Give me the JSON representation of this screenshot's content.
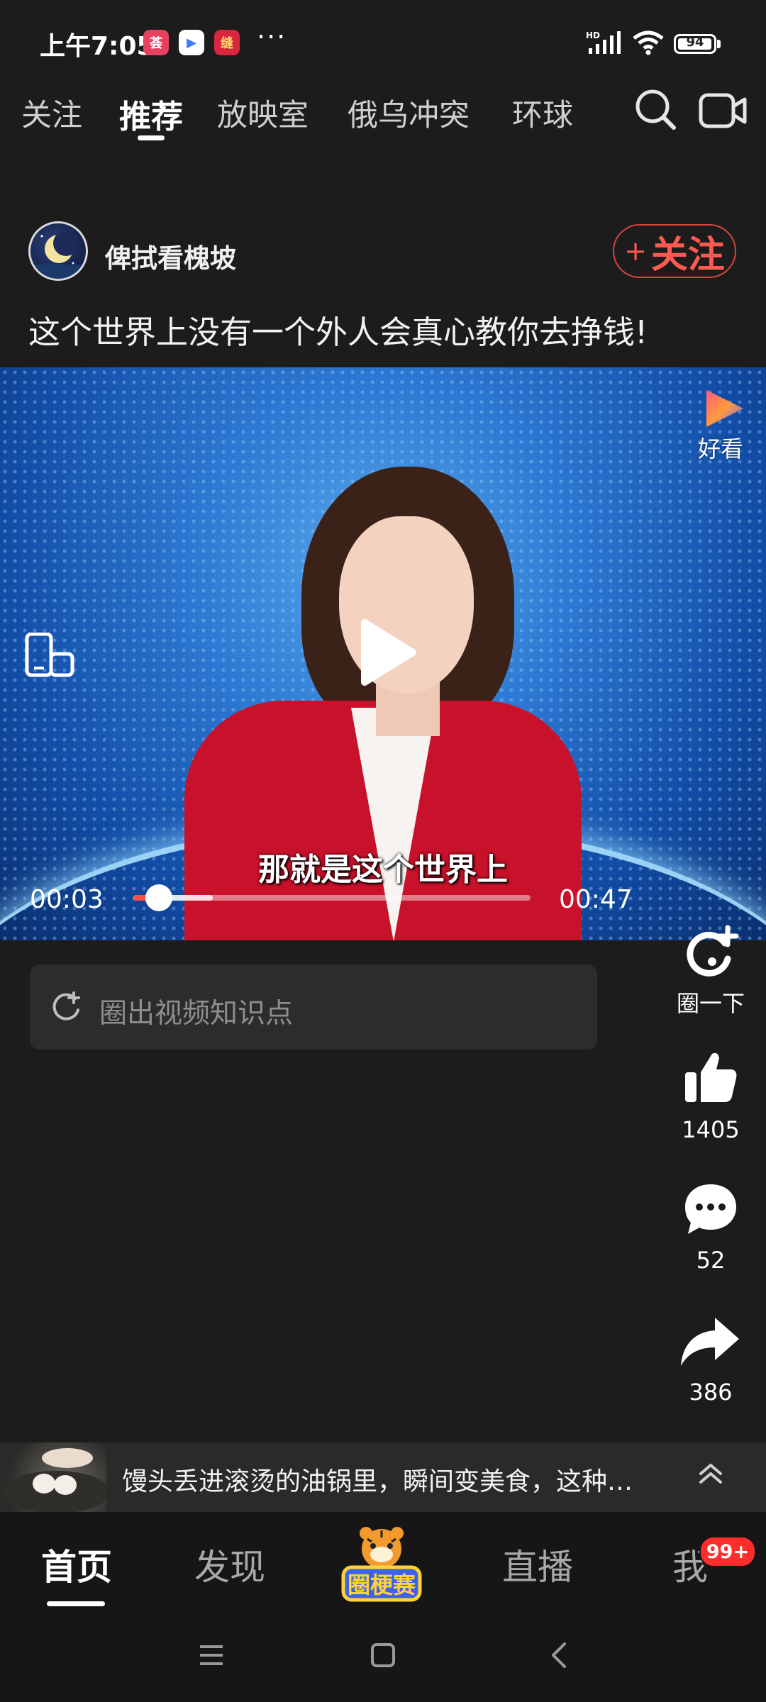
{
  "status_bar": {
    "time": "上午7:05",
    "apps": [
      {
        "name": "app-red-icon",
        "glyph": "荟",
        "bg": "#e8405f"
      },
      {
        "name": "app-play-icon",
        "glyph": "▶",
        "bg": "#ffffff"
      },
      {
        "name": "app-shop-icon",
        "glyph": "缝",
        "bg": "#d7263d"
      }
    ],
    "more": "···",
    "network": "HD",
    "battery": "94"
  },
  "tabs": [
    {
      "label": "关注",
      "active": false
    },
    {
      "label": "推荐",
      "active": true
    },
    {
      "label": "放映室",
      "active": false
    },
    {
      "label": "俄乌冲突",
      "active": false
    },
    {
      "label": "环球",
      "active": false
    }
  ],
  "post": {
    "author": "俾拭看槐坡",
    "follow_plus": "+",
    "follow_label": "关注",
    "title": "这个世界上没有一个外人会真心教你去挣钱!"
  },
  "video": {
    "watermark_label": "好看",
    "subtitle": "那就是这个世界上",
    "current_time": "00:03",
    "total_time": "00:47",
    "progress": 0.064,
    "buffered": 0.2
  },
  "knowledge_placeholder": "圈出视频知识点",
  "actions": {
    "circle_label": "圈一下",
    "likes": "1405",
    "comments": "52",
    "shares": "386"
  },
  "recommendation": {
    "text": "馒头丢进滚烫的油锅里，瞬间变美食，这种做..."
  },
  "bottom_nav": {
    "home": "首页",
    "discover": "发现",
    "center_label": "圈梗赛",
    "live": "直播",
    "me": "我",
    "badge": "99+"
  },
  "colors": {
    "accent": "#ff4e45",
    "background": "#1c1c1c"
  }
}
